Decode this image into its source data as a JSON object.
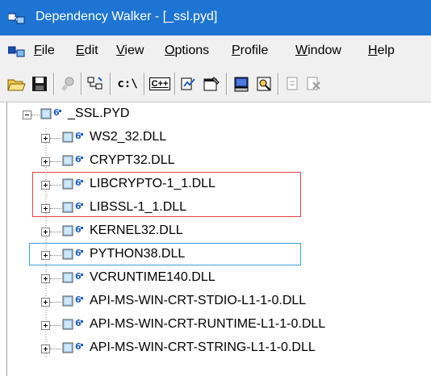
{
  "window": {
    "title": "Dependency Walker - [_ssl.pyd]"
  },
  "menu": {
    "items": [
      {
        "label": "File",
        "u": "F",
        "rest": "ile"
      },
      {
        "label": "Edit",
        "u": "E",
        "rest": "dit"
      },
      {
        "label": "View",
        "u": "V",
        "rest": "iew"
      },
      {
        "label": "Options",
        "u": "O",
        "rest": "ptions"
      },
      {
        "label": "Profile",
        "u": "P",
        "rest": "rofile"
      },
      {
        "label": "Window",
        "u": "W",
        "rest": "indow"
      },
      {
        "label": "Help",
        "u": "H",
        "rest": "elp"
      }
    ]
  },
  "toolbar": {
    "icons": [
      "open-folder-icon",
      "save-icon",
      "find-icon",
      "view-full-paths-icon",
      "cpp-undecorate-icon",
      "auto-expand-icon",
      "properties-icon",
      "system-info-icon",
      "find-module-icon",
      "copy-icon",
      "close-icon"
    ],
    "fullpaths_label": "c:\\",
    "cpp_label": "C++"
  },
  "tree": {
    "root": "_SSL.PYD",
    "children": [
      "WS2_32.DLL",
      "CRYPT32.DLL",
      "LIBCRYPTO-1_1.DLL",
      "LIBSSL-1_1.DLL",
      "KERNEL32.DLL",
      "PYTHON38.DLL",
      "VCRUNTIME140.DLL",
      "API-MS-WIN-CRT-STDIO-L1-1-0.DLL",
      "API-MS-WIN-CRT-RUNTIME-L1-1-0.DLL",
      "API-MS-WIN-CRT-STRING-L1-1-0.DLL"
    ]
  },
  "colors": {
    "titlebar": "#1e74d2",
    "highlight_red": "#e04040",
    "highlight_blue": "#3aa0d8"
  }
}
